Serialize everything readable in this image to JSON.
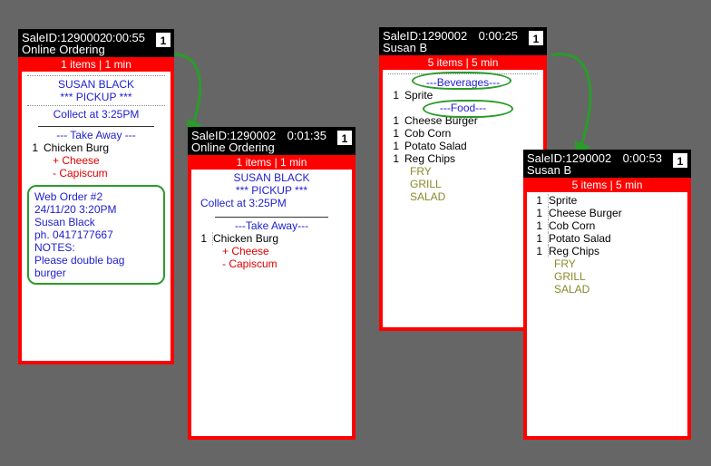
{
  "ticket1": {
    "sale_id_label": "SaleID:1290002",
    "timer": "0:00:55",
    "counter": "1",
    "subtitle": "Online Ordering",
    "summary": "1 items |   1 min",
    "customer": "SUSAN BLACK",
    "pickup_tag": "*** PICKUP ***",
    "collect": "Collect at  3:25PM",
    "service": "--- Take Away ---",
    "item_qty": "1",
    "item_name": "Chicken Burg",
    "mod_plus": "+ Cheese",
    "mod_minus": "- Capiscum",
    "notes": {
      "line1": "Web Order #2",
      "line2": "24/11/20  3:20PM",
      "line3": "Susan Black",
      "line4": "ph.  0417177667",
      "line5": "NOTES:",
      "line6": "Please double bag",
      "line7": "burger"
    }
  },
  "ticket2": {
    "sale_id_label": "SaleID:1290002",
    "timer": "0:01:35",
    "counter": "1",
    "subtitle": "Online Ordering",
    "summary": "1 items |   1 min",
    "customer": "SUSAN BLACK",
    "pickup_tag": "*** PICKUP ***",
    "collect": "Collect at  3:25PM",
    "service": "---Take Away---",
    "item_qty": "1",
    "item_name": "Chicken Burg",
    "mod_plus": "+ Cheese",
    "mod_minus": "- Capiscum"
  },
  "ticket3": {
    "sale_id_label": "SaleID:1290002",
    "timer": "0:00:25",
    "counter": "1",
    "subtitle": "Susan B",
    "summary": "5 items |   5 min",
    "cat_bev": "---Beverages---",
    "cat_food": "---Food---",
    "items": [
      {
        "qty": "1",
        "name": "Sprite"
      },
      {
        "qty": "1",
        "name": "Cheese Burger"
      },
      {
        "qty": "1",
        "name": "Cob Corn"
      },
      {
        "qty": "1",
        "name": "Potato Salad"
      },
      {
        "qty": "1",
        "name": "Reg Chips"
      }
    ],
    "stations": [
      "FRY",
      "GRILL",
      "SALAD"
    ]
  },
  "ticket4": {
    "sale_id_label": "SaleID:1290002",
    "timer": "0:00:53",
    "counter": "1",
    "subtitle": "Susan B",
    "summary": "5 items |   5 min",
    "items": [
      {
        "qty": "1",
        "name": "Sprite"
      },
      {
        "qty": "1",
        "name": "Cheese Burger"
      },
      {
        "qty": "1",
        "name": "Cob Corn"
      },
      {
        "qty": "1",
        "name": "Potato Salad"
      },
      {
        "qty": "1",
        "name": "Reg Chips"
      }
    ],
    "stations": [
      "FRY",
      "GRILL",
      "SALAD"
    ]
  }
}
